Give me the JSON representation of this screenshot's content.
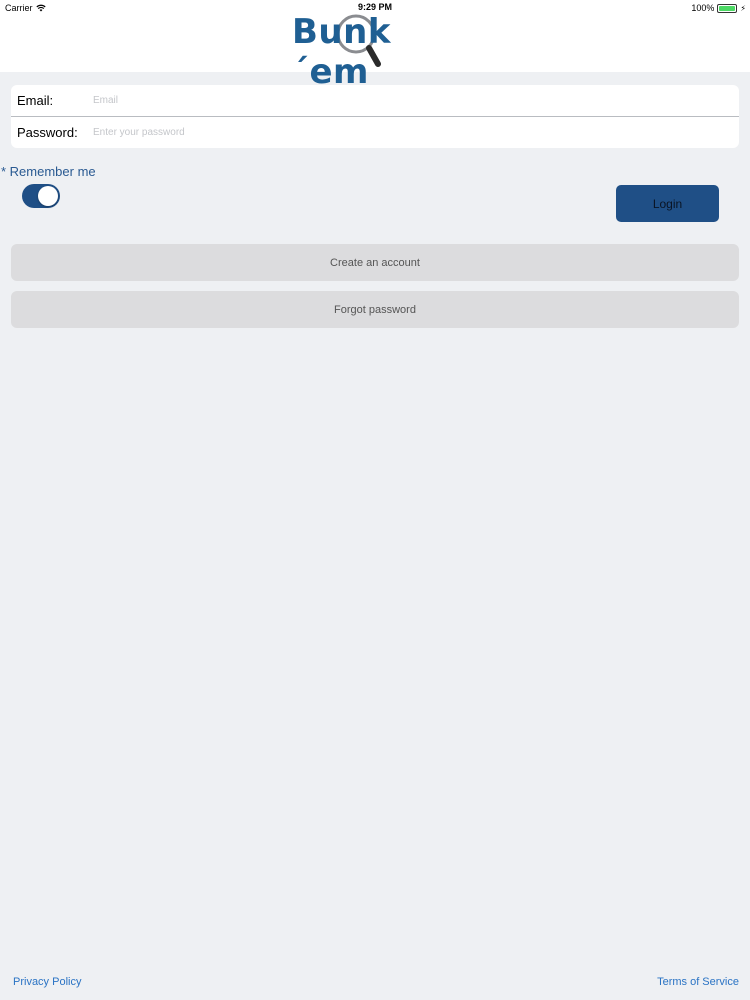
{
  "status_bar": {
    "carrier": "Carrier",
    "time": "9:29 PM",
    "battery": "100%",
    "battery_level": 1.0
  },
  "logo": {
    "text": "Bunk´em"
  },
  "form": {
    "email_label": "Email:",
    "email_placeholder": "Email",
    "email_value": "",
    "password_label": "Password:",
    "password_placeholder": "Enter your password",
    "password_value": ""
  },
  "remember": {
    "label": "* Remember me",
    "enabled": true
  },
  "buttons": {
    "login": "Login",
    "create_account": "Create an account",
    "forgot_password": "Forgot password"
  },
  "footer": {
    "privacy": "Privacy Policy",
    "terms": "Terms of Service"
  },
  "colors": {
    "primary": "#1f4f86",
    "link": "#2a73c4",
    "background": "#eef0f3",
    "secondary_button": "#dcdcde"
  }
}
